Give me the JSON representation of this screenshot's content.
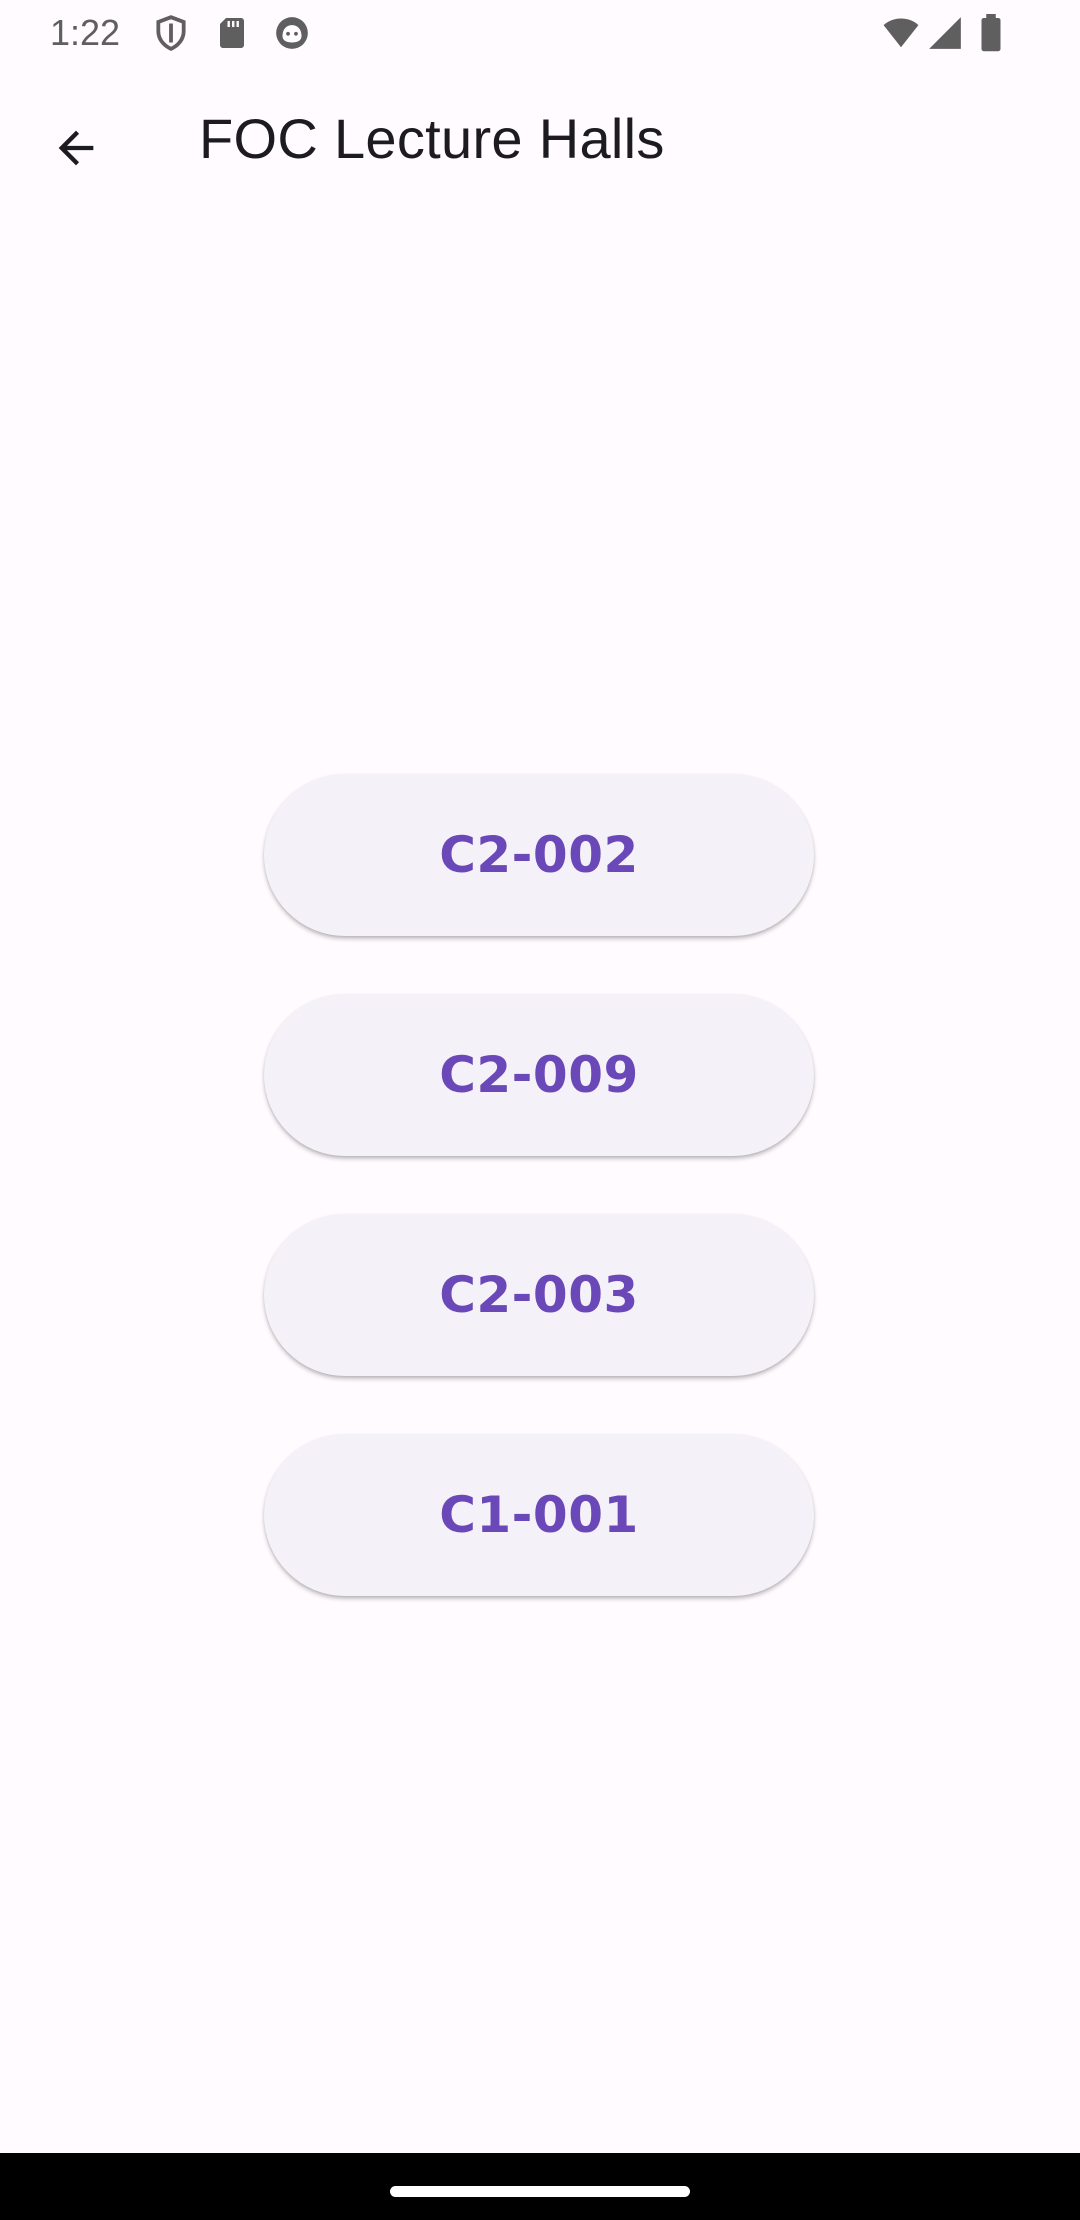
{
  "status_bar": {
    "time": "1:22",
    "icons": [
      "shield-icon",
      "sd-card-icon",
      "cat-face-icon",
      "wifi-icon",
      "signal-icon",
      "battery-icon"
    ]
  },
  "app_bar": {
    "title": "FOC Lecture Halls",
    "back_icon": "arrow-back-icon"
  },
  "halls": [
    {
      "label": "C2-002"
    },
    {
      "label": "C2-009"
    },
    {
      "label": "C2-003"
    },
    {
      "label": "C1-001"
    }
  ],
  "colors": {
    "background": "#fffbfe",
    "button_bg": "#f4f1f9",
    "button_text": "#6b48b8",
    "title_text": "#1c1b1f",
    "nav_bar": "#000000"
  }
}
